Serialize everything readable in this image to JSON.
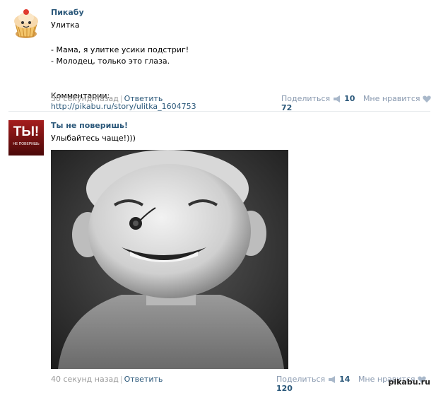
{
  "posts": [
    {
      "author": "Пикабу",
      "text_line1": "Улитка",
      "text_line2": "- Мама, я улитке усики подстриг!",
      "text_line3": "- Молодец, только это глаза.",
      "comments_label": "Комментарии:",
      "comments_link": "http://pikabu.ru/story/ulitka_1604753",
      "time": "30 секунд назад",
      "reply_label": "Ответить",
      "share_label": "Поделиться",
      "share_count": "10",
      "like_label": "Мне нравится",
      "like_count": "72"
    },
    {
      "author": "Ты не поверишь!",
      "text_line1": "Улыбайтесь чаще!)))",
      "avatar_text": "ТЫ!",
      "avatar_subtext": "НЕ ПОВЕРИШЬ",
      "time": "40 секунд назад",
      "reply_label": "Ответить",
      "share_label": "Поделиться",
      "share_count": "14",
      "like_label": "Мне нравится",
      "like_count": "120"
    }
  ],
  "watermark": "pikabu.ru",
  "colors": {
    "link": "#2b587a",
    "meta": "#999999",
    "stats": "#8a9ab0",
    "divider": "#e7eaed"
  }
}
